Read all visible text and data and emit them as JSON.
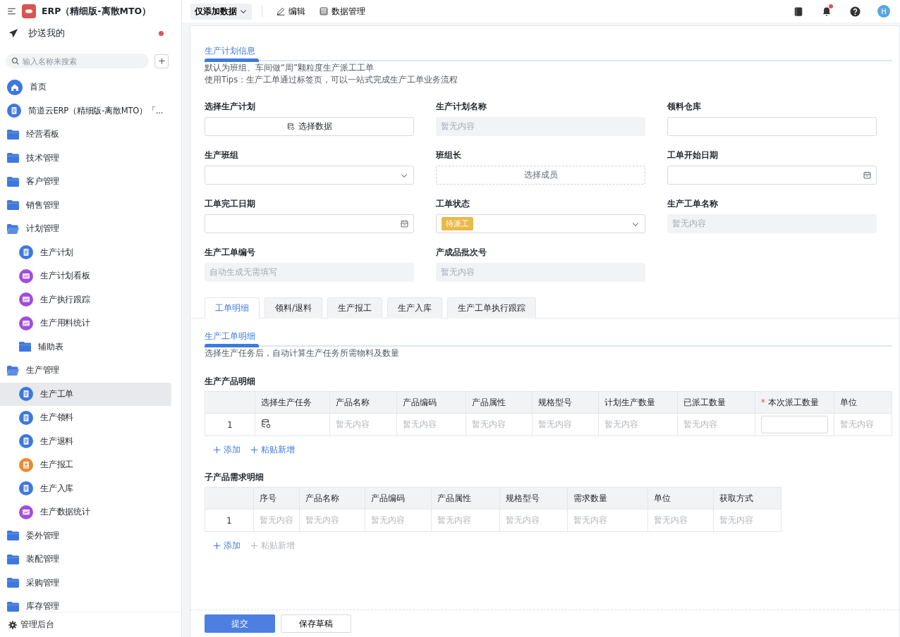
{
  "app": {
    "title": "ERP（精细版-离散MTO）"
  },
  "cc_item": {
    "label": "抄送我的",
    "unread": true
  },
  "search": {
    "placeholder": "输入名称来搜索"
  },
  "nav": [
    {
      "label": "首页",
      "kind": "home",
      "selected": false
    },
    {
      "label": "简道云ERP（精细版-离散MTO）「...",
      "kind": "form",
      "selected": false
    },
    {
      "label": "经营看板",
      "kind": "folder",
      "expanded": false,
      "selected": false
    },
    {
      "label": "技术管理",
      "kind": "folder",
      "expanded": false,
      "selected": false
    },
    {
      "label": "客户管理",
      "kind": "folder",
      "expanded": false,
      "selected": false
    },
    {
      "label": "销售管理",
      "kind": "folder",
      "expanded": false,
      "selected": false
    },
    {
      "label": "计划管理",
      "kind": "folder",
      "expanded": true,
      "selected": false,
      "children": [
        {
          "label": "生产计划",
          "kind": "form",
          "selected": false
        },
        {
          "label": "生产计划看板",
          "kind": "dashboard",
          "selected": false
        },
        {
          "label": "生产执行跟踪",
          "kind": "dashboard",
          "selected": false
        },
        {
          "label": "生产用料统计",
          "kind": "dashboard",
          "selected": false
        },
        {
          "label": "辅助表",
          "kind": "folder",
          "expanded": false,
          "selected": false
        }
      ]
    },
    {
      "label": "生产管理",
      "kind": "folder",
      "expanded": true,
      "selected": false,
      "children": [
        {
          "label": "生产工单",
          "kind": "form",
          "selected": true
        },
        {
          "label": "生产领料",
          "kind": "form",
          "selected": false
        },
        {
          "label": "生产退料",
          "kind": "form",
          "selected": false
        },
        {
          "label": "生产报工",
          "kind": "report",
          "selected": false
        },
        {
          "label": "生产入库",
          "kind": "form",
          "selected": false
        },
        {
          "label": "生产数据统计",
          "kind": "dashboard",
          "selected": false
        }
      ]
    },
    {
      "label": "委外管理",
      "kind": "folder",
      "expanded": false,
      "selected": false
    },
    {
      "label": "装配管理",
      "kind": "folder",
      "expanded": false,
      "selected": false
    },
    {
      "label": "采购管理",
      "kind": "folder",
      "expanded": false,
      "selected": false
    },
    {
      "label": "库存管理",
      "kind": "folder",
      "expanded": false,
      "selected": false
    }
  ],
  "admin": {
    "label": "管理后台"
  },
  "toolbar": {
    "mode": "仅添加数据",
    "edit": "编辑",
    "data": "数据管理",
    "notifications": true,
    "avatar": "H"
  },
  "plan_section": {
    "title": "生产计划信息",
    "description": [
      "默认为班组、车间做“周”颗粒度生产派工工单",
      "使用Tips：生产工单通过标签页，可以一站式完成生产工单业务流程"
    ]
  },
  "fields": [
    {
      "label": "选择生产计划",
      "kind": "picker",
      "text": "选择数据"
    },
    {
      "label": "生产计划名称",
      "kind": "readonly",
      "placeholder": "暂无内容"
    },
    {
      "label": "领料仓库",
      "kind": "input"
    },
    {
      "label": "生产班组",
      "kind": "select"
    },
    {
      "label": "班组长",
      "kind": "member",
      "text": "选择成员"
    },
    {
      "label": "工单开始日期",
      "kind": "date"
    },
    {
      "label": "工单完工日期",
      "kind": "date"
    },
    {
      "label": "工单状态",
      "kind": "select",
      "tag": {
        "text": "待派工",
        "color": "#e9b949"
      }
    },
    {
      "label": "生产工单名称",
      "kind": "readonly",
      "placeholder": "暂无内容"
    },
    {
      "label": "生产工单编号",
      "kind": "readonly",
      "placeholder": "自动生成无需填写"
    },
    {
      "label": "产成品批次号",
      "kind": "readonly",
      "placeholder": "暂无内容"
    }
  ],
  "tabs": [
    {
      "label": "工单明细",
      "selected": true
    },
    {
      "label": "领料/退料",
      "selected": false
    },
    {
      "label": "生产报工",
      "selected": false
    },
    {
      "label": "生产入库",
      "selected": false
    },
    {
      "label": "生产工单执行跟踪",
      "selected": false
    }
  ],
  "detail_section": {
    "title": "生产工单明细",
    "description": [
      "选择生产任务后，自动计算生产任务所需物料及数量"
    ]
  },
  "tables": [
    {
      "title": "生产产品明细",
      "columns": [
        {},
        {
          "label": "选择生产任务"
        },
        {
          "label": "产品名称"
        },
        {
          "label": "产品编码"
        },
        {
          "label": "产品属性"
        },
        {
          "label": "规格型号"
        },
        {
          "label": "计划生产数量"
        },
        {
          "label": "已派工数量"
        },
        {
          "label": "本次派工数量",
          "required_mark": "*"
        },
        {
          "label": "单位"
        }
      ],
      "rows": [
        [
          {
            "kind": "index",
            "text": "1"
          },
          {
            "kind": "picker"
          },
          {
            "kind": "empty",
            "text": "暂无内容"
          },
          {
            "kind": "empty",
            "text": "暂无内容"
          },
          {
            "kind": "empty",
            "text": "暂无内容"
          },
          {
            "kind": "empty",
            "text": "暂无内容"
          },
          {
            "kind": "empty",
            "text": "暂无内容"
          },
          {
            "kind": "empty",
            "text": "暂无内容"
          },
          {
            "kind": "input"
          },
          {
            "kind": "empty",
            "text": "暂无内容"
          }
        ]
      ],
      "actions": [
        {
          "label": "添加",
          "disabled": false
        },
        {
          "label": "粘贴新增",
          "disabled": false
        }
      ]
    },
    {
      "title": "子产品需求明细",
      "columns": [
        {},
        {
          "label": "序号"
        },
        {
          "label": "产品名称"
        },
        {
          "label": "产品编码"
        },
        {
          "label": "产品属性"
        },
        {
          "label": "规格型号"
        },
        {
          "label": "需求数量"
        },
        {
          "label": "单位"
        },
        {
          "label": "获取方式"
        }
      ],
      "rows": [
        [
          {
            "kind": "index",
            "text": "1"
          },
          {
            "kind": "empty",
            "text": "暂无内容"
          },
          {
            "kind": "empty",
            "text": "暂无内容"
          },
          {
            "kind": "empty",
            "text": "暂无内容"
          },
          {
            "kind": "empty",
            "text": "暂无内容"
          },
          {
            "kind": "empty",
            "text": "暂无内容"
          },
          {
            "kind": "empty",
            "text": "暂无内容"
          },
          {
            "kind": "empty",
            "text": "暂无内容"
          },
          {
            "kind": "empty",
            "text": "暂无内容"
          }
        ]
      ],
      "actions": [
        {
          "label": "添加",
          "disabled": false
        },
        {
          "label": "粘贴新增",
          "disabled": true
        }
      ]
    }
  ],
  "footer": {
    "submit": "提交",
    "draft": "保存草稿"
  }
}
